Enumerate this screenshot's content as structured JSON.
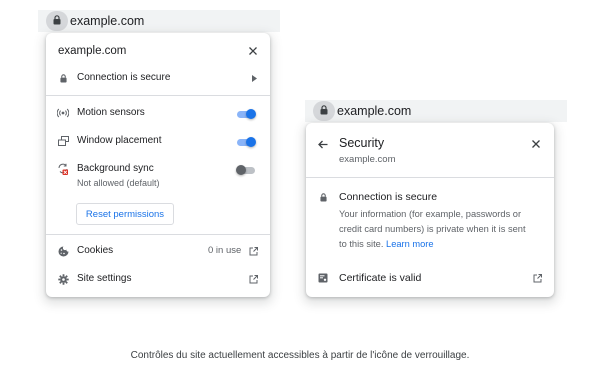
{
  "left": {
    "url": "example.com",
    "popup": {
      "title": "example.com",
      "connection_label": "Connection is secure",
      "permissions": [
        {
          "label": "Motion sensors",
          "state": "on"
        },
        {
          "label": "Window placement",
          "state": "on"
        },
        {
          "label": "Background sync",
          "sublabel": "Not allowed (default)",
          "state": "off"
        }
      ],
      "reset_label": "Reset permissions",
      "cookies_label": "Cookies",
      "cookies_count": "0 in use",
      "site_settings_label": "Site settings"
    }
  },
  "right": {
    "url": "example.com",
    "popup": {
      "title": "Security",
      "subtitle": "example.com",
      "connection_label": "Connection is secure",
      "description_lines": [
        "Your information (for example, passwords or",
        "credit card numbers) is private when it is sent",
        "to this site."
      ],
      "learn_more": "Learn more",
      "certificate_label": "Certificate is valid"
    }
  },
  "caption": "Contrôles du site actuellement accessibles à partir de l'icône de verrouillage.",
  "colors": {
    "accent": "#1a73e8",
    "toggle_on_track": "#8ab4f8",
    "toggle_off_knob": "#5f6368",
    "blocked_badge": "#d93025"
  }
}
